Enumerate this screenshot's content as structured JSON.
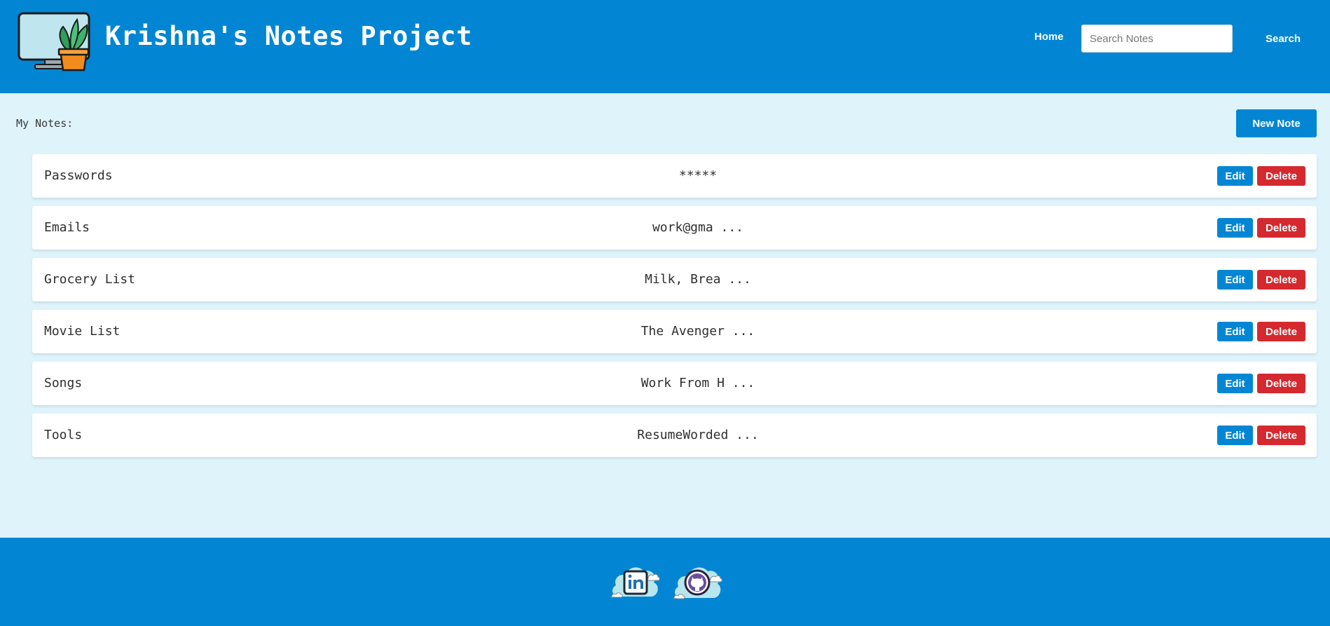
{
  "header": {
    "title": "Krishna's Notes Project",
    "logo_icon": "monitor-plant-icon",
    "nav_home_label": "Home",
    "search_placeholder": "Search Notes",
    "search_value": "",
    "search_button_label": "Search"
  },
  "main": {
    "section_label": "My Notes:",
    "new_note_label": "New Note",
    "notes": [
      {
        "title": "Passwords",
        "preview": "*****",
        "edit_label": "Edit",
        "delete_label": "Delete"
      },
      {
        "title": "Emails",
        "preview": "work@gma ...",
        "edit_label": "Edit",
        "delete_label": "Delete"
      },
      {
        "title": "Grocery List",
        "preview": "Milk, Brea ...",
        "edit_label": "Edit",
        "delete_label": "Delete"
      },
      {
        "title": "Movie List",
        "preview": "The Avenger ...",
        "edit_label": "Edit",
        "delete_label": "Delete"
      },
      {
        "title": "Songs",
        "preview": "Work From H ...",
        "edit_label": "Edit",
        "delete_label": "Delete"
      },
      {
        "title": "Tools",
        "preview": "ResumeWorded ...",
        "edit_label": "Edit",
        "delete_label": "Delete"
      }
    ]
  },
  "footer": {
    "links": [
      {
        "icon": "linkedin-cloud-icon"
      },
      {
        "icon": "github-cloud-icon"
      }
    ]
  },
  "colors": {
    "primary": "#0286d3",
    "background": "#def4fa",
    "danger": "#d4292f",
    "card": "#ffffff"
  }
}
